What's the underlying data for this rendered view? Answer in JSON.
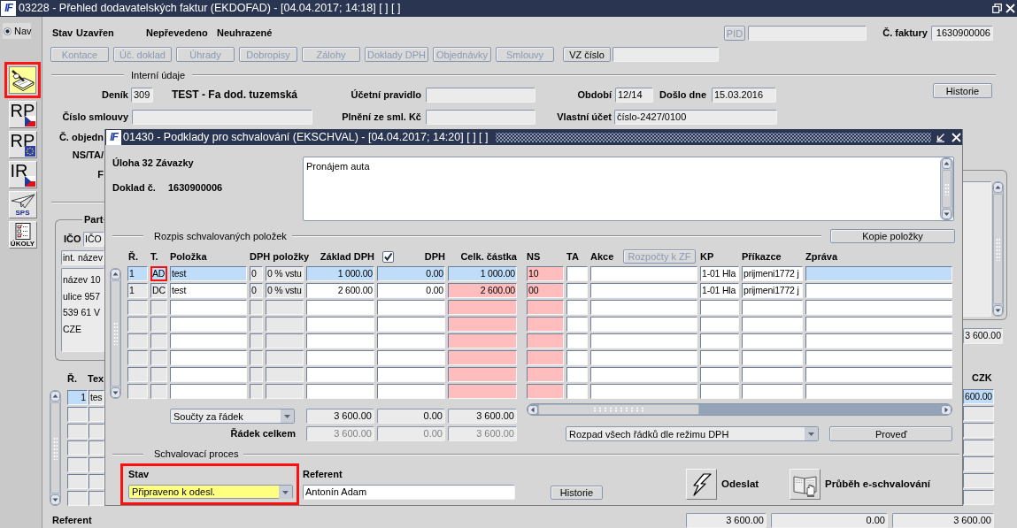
{
  "window": {
    "logo": "IF",
    "title": "03228 - Přehled dodavatelských faktur (EKDOFAD) - [04.04.2017; 14:18] [ ] [ ]"
  },
  "toolbar": {
    "nav": {
      "label": "Nav",
      "selected": true
    },
    "tools": [
      {
        "kind": "pen",
        "highlighted": true
      },
      {
        "kind": "flag-cz",
        "label": "RP",
        "highlighted": false
      },
      {
        "kind": "flag-eu",
        "label": "RP",
        "highlighted": false
      },
      {
        "kind": "flag-cz",
        "label": "IR",
        "highlighted": false
      },
      {
        "kind": "plane",
        "label": "SPS",
        "highlighted": false
      },
      {
        "kind": "checklist",
        "label": "ÚKOLY",
        "highlighted": false
      }
    ]
  },
  "header": {
    "status_label": "Stav",
    "status": "Uzavřen",
    "transfer_status": "Nepřevedeno",
    "payment_status": "Neuhrazené",
    "pid_button": {
      "label": "PID",
      "disabled": true
    },
    "invoice_number": {
      "label": "Č. faktury",
      "value": "1630900006"
    },
    "buttons": [
      {
        "label": "Kontace",
        "disabled": true
      },
      {
        "label": "Úč. doklad",
        "disabled": true
      },
      {
        "label": "Úhrady",
        "disabled": true
      },
      {
        "label": "Dobropisy",
        "disabled": true
      },
      {
        "label": "Zálohy",
        "disabled": true
      },
      {
        "label": "Doklady DPH",
        "disabled": true
      },
      {
        "label": "Objednávky",
        "disabled": true
      },
      {
        "label": "Smlouvy",
        "disabled": true
      },
      {
        "label": "VZ číslo",
        "disabled": false
      }
    ]
  },
  "internal": {
    "title": "Interní údaje",
    "journal": {
      "label": "Deník",
      "value": "309",
      "name": "TEST - Fa dod. tuzemská"
    },
    "accounting_rule": {
      "label": "Účetní pravidlo"
    },
    "period": {
      "label": "Období",
      "value": "12/14"
    },
    "received": {
      "label": "Došlo dne",
      "value": "15.03.2016"
    },
    "history_button": "Historie",
    "contract_number": {
      "label": "Číslo smlouvy"
    },
    "contract_amount": {
      "label": "Plnění ze sml. Kč"
    },
    "own_account": {
      "label": "Vlastní účet",
      "value": "číslo-2427/0100"
    },
    "order_label": "Č. objedn",
    "ns_label": "NS/TA/",
    "label_3": "F"
  },
  "partner": {
    "title": "Part",
    "ico": {
      "label": "IČO",
      "value": "IČO"
    },
    "name_value": "int. název",
    "address_lines": [
      "název 10",
      "ulice 957",
      "539 61 V",
      "CZE"
    ]
  },
  "right_panel": {
    "amount": "3 600.00"
  },
  "lines": {
    "columns": [
      "Ř.",
      "Tex",
      "CZK"
    ],
    "rows": [
      {
        "selected": true,
        "number": "1",
        "text": "tes",
        "czk": "600.00"
      },
      {
        "selected": false
      },
      {
        "selected": false
      },
      {
        "selected": false
      },
      {
        "selected": false
      },
      {
        "selected": false
      },
      {
        "selected": false
      }
    ]
  },
  "footer": {
    "referent_label": "Referent",
    "totals": [
      "3 600.00",
      "0.00",
      "3 600.00"
    ]
  },
  "dialog": {
    "logo": "IF",
    "title": "01430 - Podklady pro schvalování (EKSCHVAL) - [04.04.2017; 14:20] [ ] [ ]",
    "task": "Úloha 32 Závazky",
    "document": {
      "label": "Doklad č.",
      "value": "1630900006"
    },
    "note": "Pronájem auta",
    "items": {
      "title": "Rozpis schvalovaných položek",
      "copy_button": "Kopie položky",
      "columns": [
        "Ř.",
        "T.",
        "Položka",
        "DPH položky",
        "Základ DPH",
        "DPH",
        "Celk. částka",
        "NS",
        "TA",
        "Akce",
        "KP",
        "Příkazce",
        "Zpráva"
      ],
      "vat_checked": true,
      "budget_button": {
        "label": "Rozpočty k ZF",
        "disabled": true
      },
      "rows": [
        {
          "selected": true,
          "type_highlighted": true,
          "number": "1",
          "type": "AD",
          "item": "test",
          "vat_code": "0",
          "vat_item": "0 % vstu",
          "base": "1 000.00",
          "vat": "0.00",
          "total": "1 000.00",
          "ns": "10",
          "kp": "1-01 Hla",
          "orderer": "prijmeni1772 j"
        },
        {
          "selected": false,
          "type_highlighted": false,
          "number": "1",
          "type": "DC",
          "item": "test",
          "vat_code": "0",
          "vat_item": "0 % vstu",
          "base": "2 600.00",
          "vat": "0.00",
          "total": "2 600.00",
          "ns": "00",
          "kp": "1-01 Hla",
          "orderer": "prijmeni1772 j"
        },
        {
          "selected": false,
          "type_highlighted": false
        },
        {
          "selected": false,
          "type_highlighted": false
        },
        {
          "selected": false,
          "type_highlighted": false
        },
        {
          "selected": false,
          "type_highlighted": false
        },
        {
          "selected": false,
          "type_highlighted": false
        },
        {
          "selected": false,
          "type_highlighted": false
        }
      ],
      "sum_mode": "Součty za řádek",
      "sums": [
        "3 600.00",
        "0.00",
        "3 600.00"
      ],
      "row_total": {
        "label": "Řádek celkem",
        "disabled": true,
        "values": [
          "3 600.00",
          "0.00",
          "3 600.00"
        ]
      },
      "split_mode": "Rozpad všech řádků dle režimu DPH",
      "run_button": "Proveď"
    },
    "approval": {
      "title": "Schvalovací proces",
      "state": {
        "label": "Stav",
        "value": "Připraveno k odesl.",
        "highlighted": true
      },
      "referent": {
        "label": "Referent",
        "value": "Antonín Adam"
      },
      "history_button": "Historie",
      "send_label": "Odeslat",
      "progress_label": "Průběh e-schvalování"
    }
  }
}
